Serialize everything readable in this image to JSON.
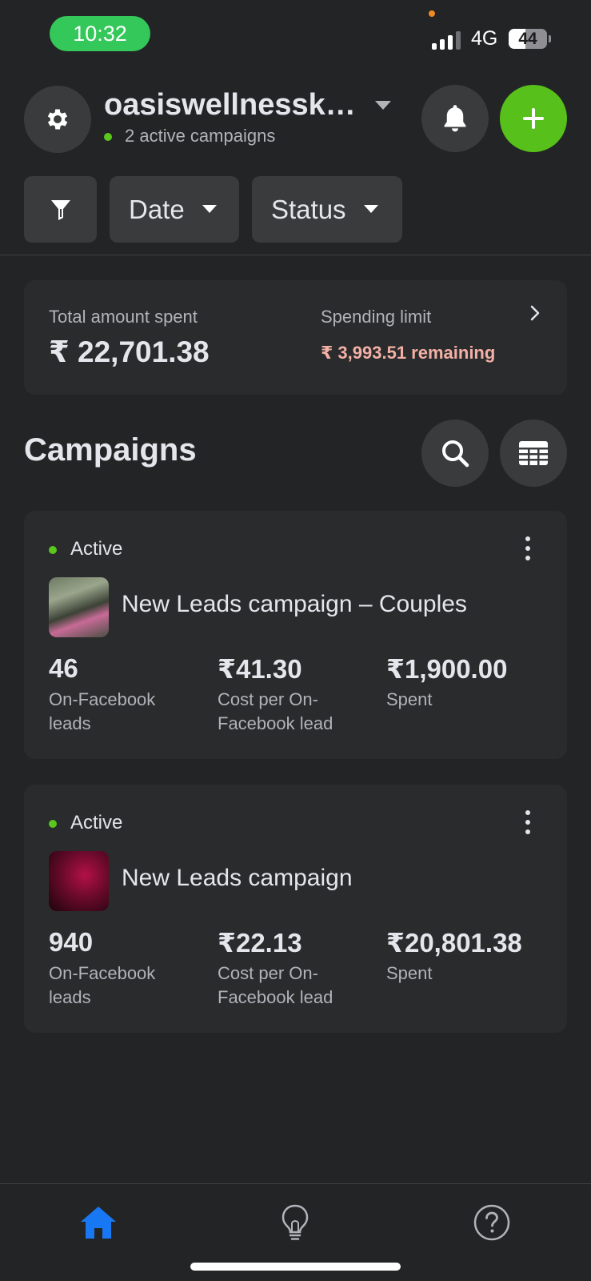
{
  "status_bar": {
    "time": "10:32",
    "network": "4G",
    "battery_level": "44",
    "signal_bars": 3,
    "colors": {
      "time_pill": "#34c759",
      "mic_dot": "#f08a24"
    }
  },
  "header": {
    "account_name": "oasiswellnessk…",
    "active_campaigns": "2 active campaigns",
    "icons": {
      "settings": "gear-icon",
      "notifications": "bell-icon",
      "create": "plus-icon"
    },
    "accent_color": "#57c01a"
  },
  "filters": {
    "filter_icon": "funnel-icon",
    "date_label": "Date",
    "status_label": "Status"
  },
  "spend": {
    "total_label": "Total amount spent",
    "total_value": "₹ 22,701.38",
    "limit_label": "Spending limit",
    "limit_remaining": "₹ 3,993.51 remaining",
    "remaining_color": "#f3b0a5"
  },
  "campaigns": {
    "title": "Campaigns",
    "icons": {
      "search": "search-icon",
      "columns": "table-icon"
    },
    "items": [
      {
        "status": "Active",
        "name": "New Leads campaign – Couples",
        "metrics": [
          {
            "value": "46",
            "label": "On-Facebook leads"
          },
          {
            "value": "₹41.30",
            "label": "Cost per On-Facebook lead"
          },
          {
            "value": "₹1,900.00",
            "label": "Spent"
          }
        ]
      },
      {
        "status": "Active",
        "name": "New Leads campaign",
        "metrics": [
          {
            "value": "940",
            "label": "On-Facebook leads"
          },
          {
            "value": "₹22.13",
            "label": "Cost per On-Facebook lead"
          },
          {
            "value": "₹20,801.38",
            "label": "Spent"
          }
        ]
      }
    ]
  },
  "bottom_nav": {
    "items": [
      {
        "icon": "home-icon",
        "selected": true,
        "color": "#1877f2"
      },
      {
        "icon": "lightbulb-icon",
        "selected": false
      },
      {
        "icon": "help-icon",
        "selected": false
      }
    ]
  }
}
